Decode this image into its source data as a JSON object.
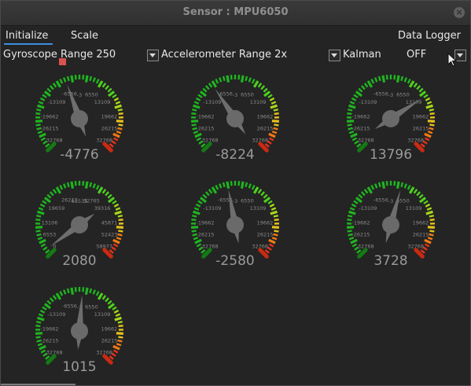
{
  "window": {
    "title": "Sensor : MPU6050",
    "close_icon": "close-icon"
  },
  "menu": {
    "initialize": "Initialize",
    "scale": "Scale",
    "data_logger": "Data Logger"
  },
  "controls": {
    "gyro_range": "Gyroscope Range 250",
    "accel_range": "Accelerometer Range 2x",
    "kalman": "Kalman",
    "kalman_state": "OFF"
  },
  "gauges": [
    {
      "value": "-4776",
      "value_num": -4776,
      "min": -32768,
      "max": 32768,
      "ticks": [
        "-6556",
        "6550",
        "13109",
        "-13109",
        "19662",
        "-19662",
        "26215",
        "-26215",
        "32768",
        "32768",
        "-3"
      ]
    },
    {
      "value": "-8224",
      "value_num": -8224,
      "min": -32768,
      "max": 32768,
      "ticks": [
        "-6556",
        "6550",
        "13109",
        "-13109",
        "19662",
        "-19662",
        "26215",
        "-26215",
        "32768",
        "32768",
        "-3"
      ]
    },
    {
      "value": "13796",
      "value_num": 13796,
      "min": -32768,
      "max": 32768,
      "ticks": [
        "-6556",
        "6550",
        "13109",
        "-13109",
        "19662",
        "-19662",
        "26215",
        "-26215",
        "32768",
        "32768",
        "-3"
      ]
    },
    {
      "value": "2080",
      "value_num": 2080,
      "min": 0,
      "max": 65535,
      "ticks": [
        "26213",
        "32765",
        "39316",
        "19659",
        "45871",
        "13106",
        "52423",
        "6553",
        "58977",
        "0",
        "65535"
      ]
    },
    {
      "value": "-2580",
      "value_num": -2580,
      "min": -32768,
      "max": 32768,
      "ticks": [
        "-6556",
        "6550",
        "13109",
        "-13109",
        "19662",
        "-19662",
        "26215",
        "-26215",
        "32768",
        "32768",
        "-3"
      ]
    },
    {
      "value": "3728",
      "value_num": 3728,
      "min": -32768,
      "max": 32768,
      "ticks": [
        "-6556",
        "6550",
        "13109",
        "-13109",
        "19662",
        "-19662",
        "26215",
        "-26215",
        "32768",
        "32768",
        "-3"
      ]
    },
    {
      "value": "1015",
      "value_num": 1015,
      "min": -32768,
      "max": 32768,
      "ticks": [
        "-6556",
        "6550",
        "13109",
        "-13109",
        "19662",
        "-19662",
        "26215",
        "-26215",
        "32768",
        "32768",
        "-3"
      ]
    }
  ]
}
